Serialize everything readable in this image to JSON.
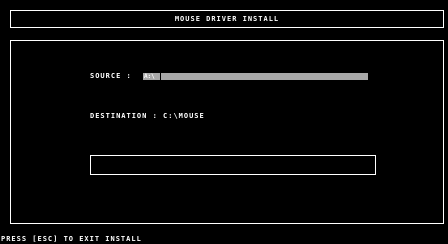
{
  "window": {
    "title": "MOUSE DRIVER INSTALL"
  },
  "form": {
    "source_label": "SOURCE : ",
    "source_value": "A:\\",
    "destination_label": "DESTINATION : ",
    "destination_value": "C:\\MOUSE"
  },
  "message_box": {
    "text": ""
  },
  "status_bar": {
    "text": "PRESS [ESC] TO EXIT INSTALL"
  },
  "colors": {
    "background": "#000000",
    "foreground": "#ffffff",
    "input_fill": "#a8a8a8"
  }
}
